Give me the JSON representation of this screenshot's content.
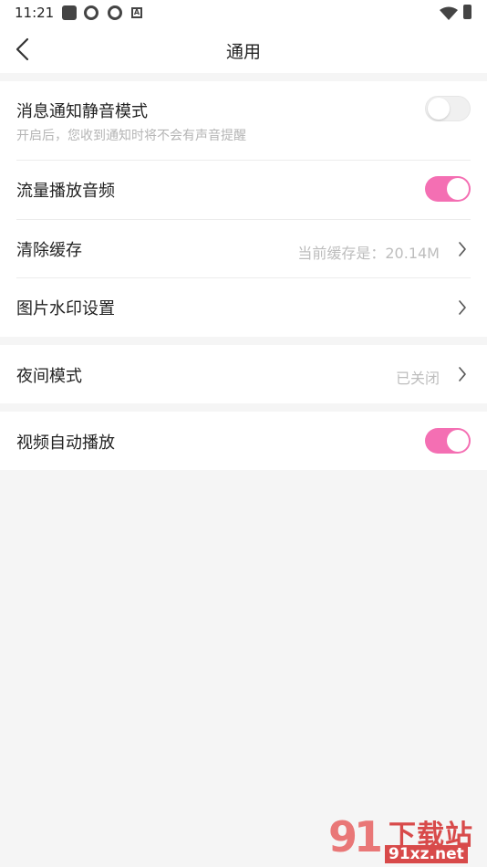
{
  "status_bar": {
    "time": "11:21",
    "left_icons": [
      "square-icon",
      "pinwheel-icon",
      "pinwheel-icon",
      "a-badge-icon"
    ],
    "a_badge": "A",
    "right_icons": [
      "wifi-icon",
      "battery-icon"
    ]
  },
  "header": {
    "title": "通用",
    "back_icon": "back-chevron-icon"
  },
  "settings": {
    "mute_notifications": {
      "label": "消息通知静音模式",
      "description": "开启后，您收到通知时将不会有声音提醒",
      "enabled": false
    },
    "cellular_audio": {
      "label": "流量播放音频",
      "enabled": true
    },
    "clear_cache": {
      "label": "清除缓存",
      "value": "当前缓存是：20.14M"
    },
    "image_watermark": {
      "label": "图片水印设置"
    },
    "night_mode": {
      "label": "夜间模式",
      "value": "已关闭"
    },
    "video_autoplay": {
      "label": "视频自动播放",
      "enabled": true
    }
  },
  "colors": {
    "accent": "#f46fb3",
    "background": "#f5f5f5",
    "card": "#ffffff"
  },
  "watermark": {
    "logo": "91",
    "title": "下载站",
    "url": "91xz.net"
  }
}
